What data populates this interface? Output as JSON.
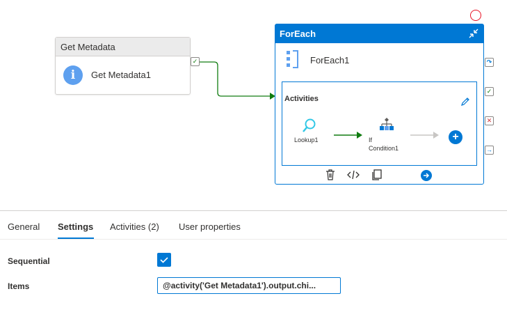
{
  "canvas": {
    "get_metadata": {
      "header": "Get Metadata",
      "name": "Get Metadata1",
      "icon": "info-icon"
    },
    "foreach": {
      "header": "ForEach",
      "name": "ForEach1",
      "activities_title": "Activities",
      "inner": {
        "lookup_label": "Lookup1",
        "if_label_line1": "If",
        "if_label_line2": "Condition1",
        "add_icon": "+"
      }
    },
    "colors": {
      "accent": "#0078d4",
      "success": "#107c10",
      "fail": "#d13438",
      "breakpoint": "#e81123"
    }
  },
  "panel": {
    "tabs": [
      {
        "label": "General"
      },
      {
        "label": "Settings",
        "active": true
      },
      {
        "label": "Activities (2)"
      },
      {
        "label": "User properties"
      }
    ],
    "sequential_label": "Sequential",
    "sequential_checked": true,
    "items_label": "Items",
    "items_value": "@activity('Get Metadata1').output.chi..."
  }
}
